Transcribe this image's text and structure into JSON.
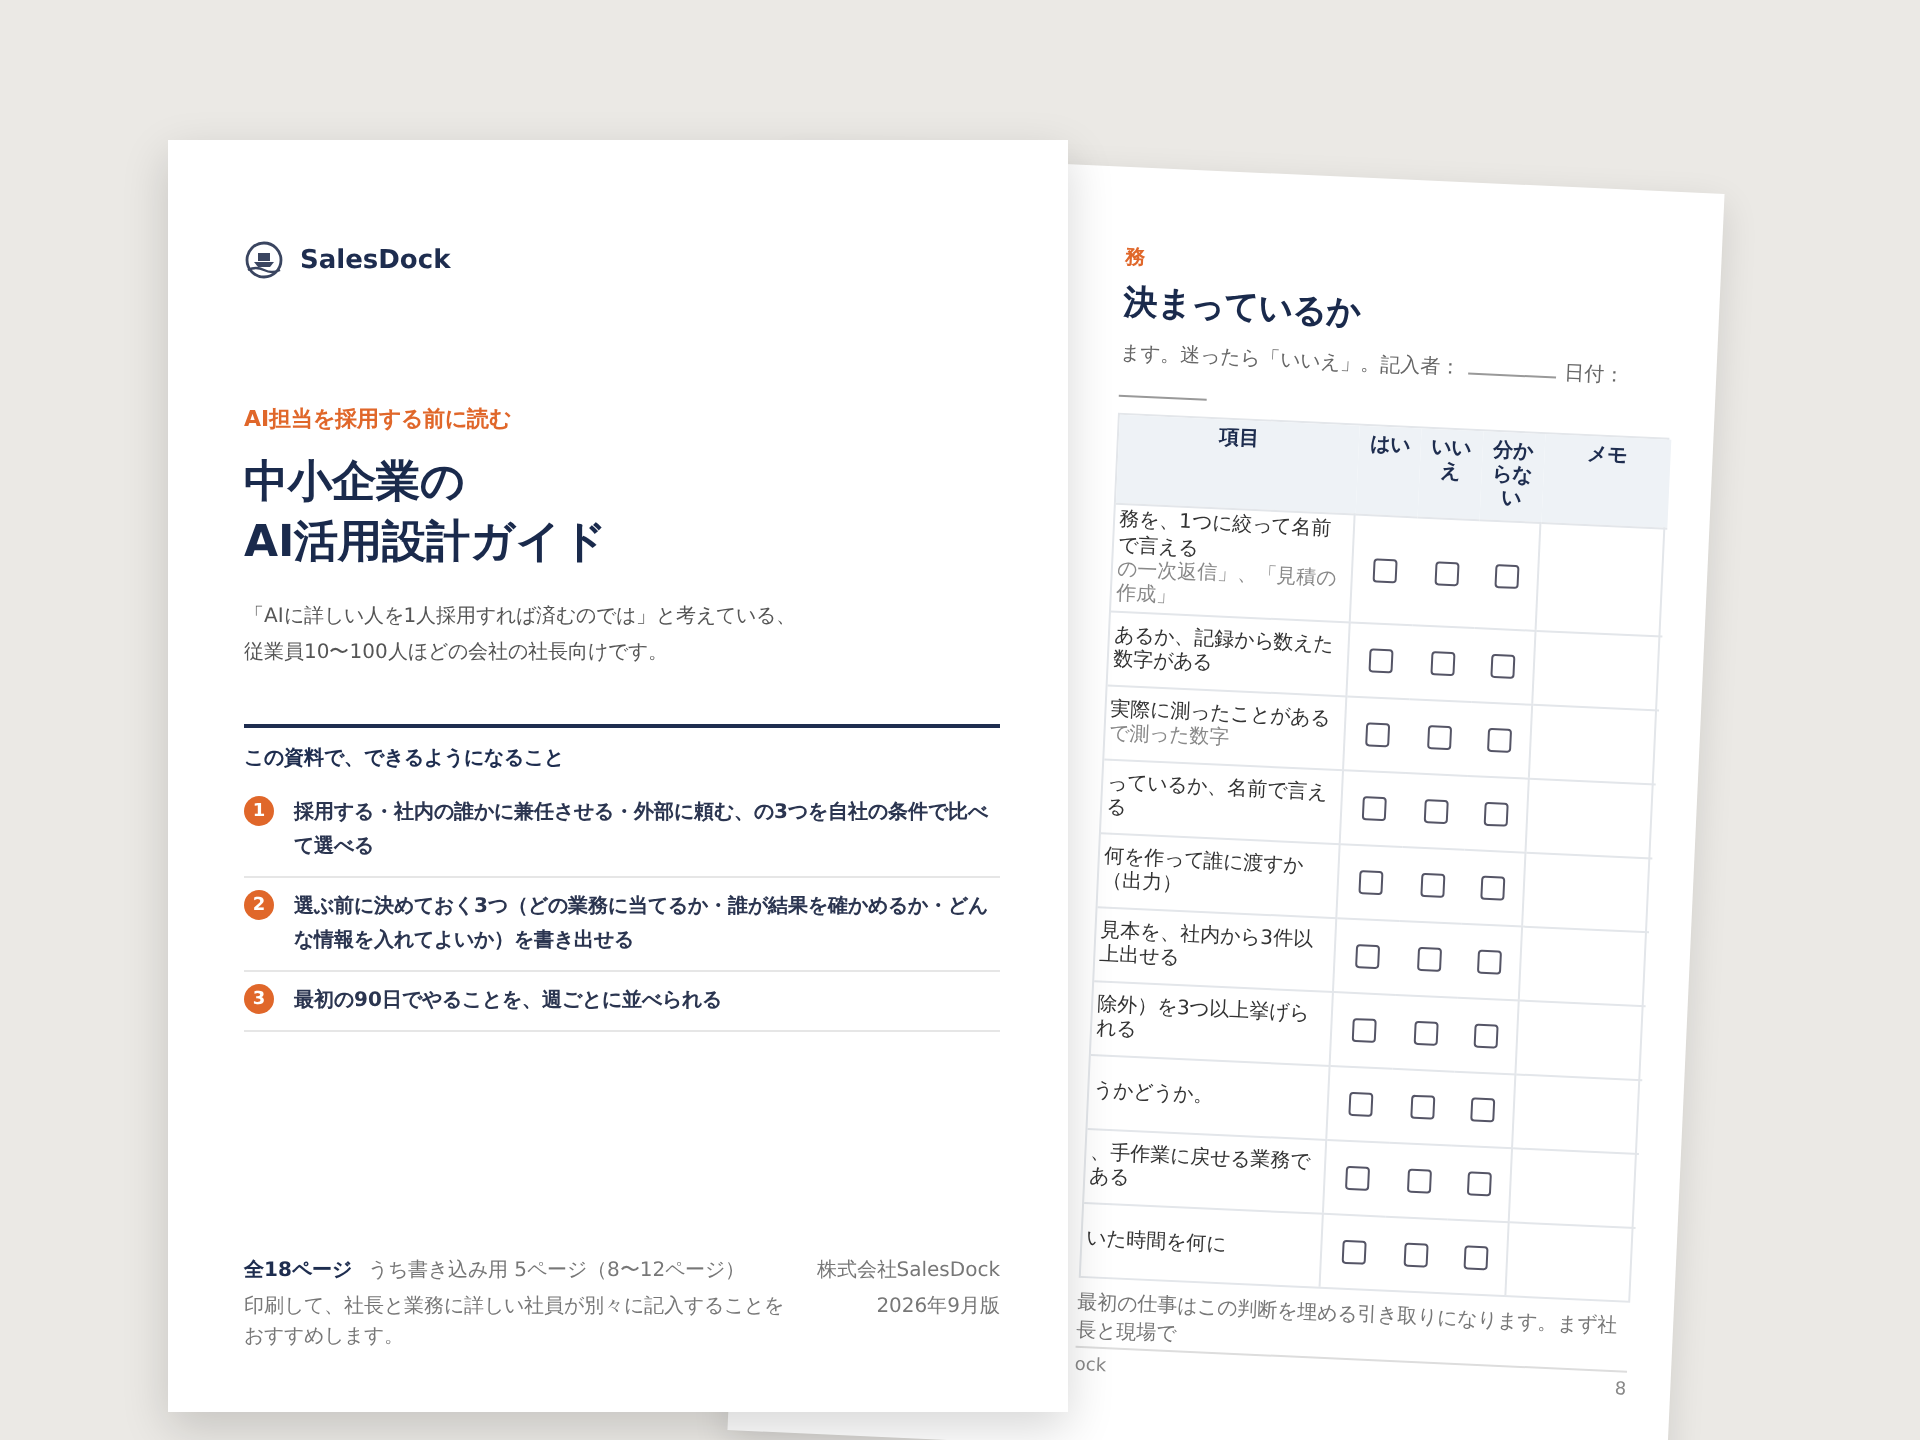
{
  "front_page": {
    "brand": "SalesDock",
    "eyebrow": "AI担当を採用する前に読む",
    "title_lines": [
      "中小企業の",
      "AI活用設計ガイド"
    ],
    "lead_lines": [
      "「AIに詳しい人を1人採用すれば済むのでは」と考えている、",
      "従業員10〜100人ほどの会社の社長向けです。"
    ],
    "outcomes_heading": "この資料で、できるようになること",
    "outcomes": [
      {
        "number": "1",
        "text": "採用する・社内の誰かに兼任させる・外部に頼む、の3つを自社の条件で比べて選べる"
      },
      {
        "number": "2",
        "text": "選ぶ前に決めておく3つ（どの業務に当てるか・誰が結果を確かめるか・どんな情報を入れてよいか）を書き出せる"
      },
      {
        "number": "3",
        "text": "最初の90日でやることを、週ごとに並べられる"
      }
    ],
    "footer": {
      "page_count": "全18ページ",
      "page_note": "うち書き込み用 5ページ（8〜12ページ）",
      "advice": "印刷して、社長と業務に詳しい社員が別々に記入することをおすすめします。",
      "publisher": "株式会社SalesDock",
      "edition": "2026年9月版"
    }
  },
  "back_page": {
    "section_label": "務",
    "title": "決まっているか",
    "instruction": "ます。迷ったら「いいえ」。記入者：",
    "date_label": "日付：",
    "columns": [
      "項目",
      "はい",
      "いいえ",
      "分からない",
      "メモ"
    ],
    "rows": [
      {
        "text": "務を、1つに絞って名前で言える",
        "note": "の一次返信」、「見積の作成」",
        "answers": [
          {
            "checked": false
          },
          {
            "checked": false
          },
          {
            "checked": false
          }
        ]
      },
      {
        "text": "あるか、記録から数えた数字がある",
        "answers": [
          {
            "checked": false
          },
          {
            "checked": false
          },
          {
            "checked": false
          }
        ]
      },
      {
        "text": "実際に測ったことがある",
        "note": "で測った数字",
        "answers": [
          {
            "checked": false
          },
          {
            "checked": false
          },
          {
            "checked": false
          }
        ]
      },
      {
        "text": "っているか、名前で言える",
        "answers": [
          {
            "checked": false
          },
          {
            "checked": false
          },
          {
            "checked": false
          }
        ]
      },
      {
        "text": "何を作って誰に渡すか（出力）",
        "answers": [
          {
            "checked": false
          },
          {
            "checked": false
          },
          {
            "checked": false
          }
        ]
      },
      {
        "text": "見本を、社内から3件以上出せる",
        "answers": [
          {
            "checked": false
          },
          {
            "checked": false
          },
          {
            "checked": false
          }
        ]
      },
      {
        "text": "除外）を3つ以上挙げられる",
        "answers": [
          {
            "checked": false
          },
          {
            "checked": false
          },
          {
            "checked": false
          }
        ]
      },
      {
        "text": "うかどうか。",
        "answers": [
          {
            "checked": false
          },
          {
            "checked": false
          },
          {
            "checked": false
          }
        ]
      },
      {
        "text": "、手作業に戻せる業務である",
        "answers": [
          {
            "checked": false
          },
          {
            "checked": false
          },
          {
            "checked": false
          }
        ]
      },
      {
        "text": "いた時間を何に",
        "answers": [
          {
            "checked": false
          },
          {
            "checked": false
          },
          {
            "checked": false
          }
        ]
      }
    ],
    "note": "最初の仕事はこの判断を埋める引き取りになります。まず社長と現場で",
    "footer_text": "ock",
    "page_number": "8"
  }
}
